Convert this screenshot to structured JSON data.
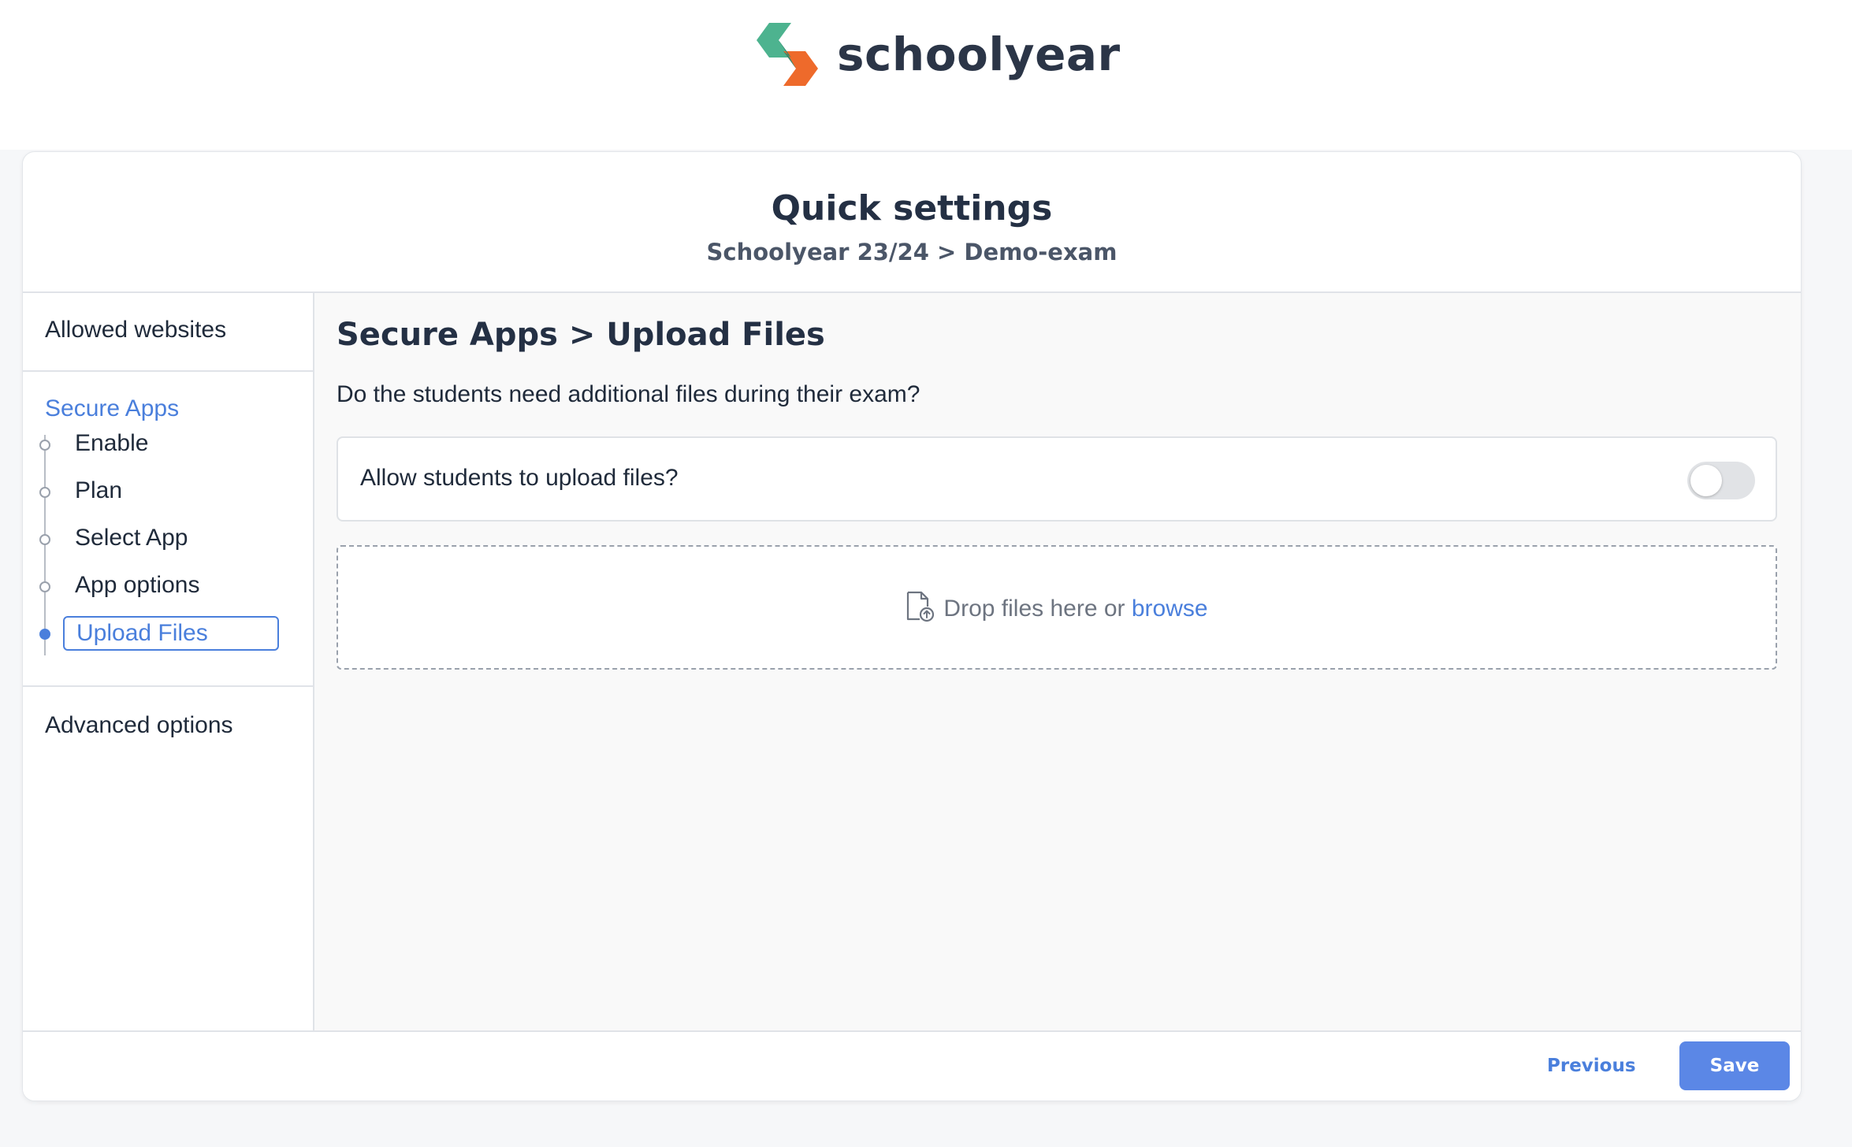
{
  "brand": {
    "name": "schoolyear",
    "colors": {
      "green": "#4db38f",
      "orange": "#ee6a2b",
      "teal": "#2e8a6e"
    }
  },
  "header": {
    "title": "Quick settings",
    "subtitle": "Schoolyear 23/24 > Demo-exam"
  },
  "sidebar": {
    "allowed_websites": "Allowed websites",
    "secure_apps": {
      "label": "Secure Apps",
      "items": [
        {
          "label": "Enable",
          "active": false
        },
        {
          "label": "Plan",
          "active": false
        },
        {
          "label": "Select App",
          "active": false
        },
        {
          "label": "App options",
          "active": false
        },
        {
          "label": "Upload Files",
          "active": true
        }
      ]
    },
    "advanced_options": "Advanced options"
  },
  "main": {
    "title": "Secure Apps > Upload Files",
    "question": "Do the students need additional files during their exam?",
    "toggle": {
      "label": "Allow students to upload files?",
      "enabled": false
    },
    "dropzone": {
      "icon": "file-upload-icon",
      "text": "Drop files here or ",
      "link": "browse"
    }
  },
  "footer": {
    "previous_label": "Previous",
    "save_label": "Save",
    "accent_color": "#5b87e6"
  }
}
